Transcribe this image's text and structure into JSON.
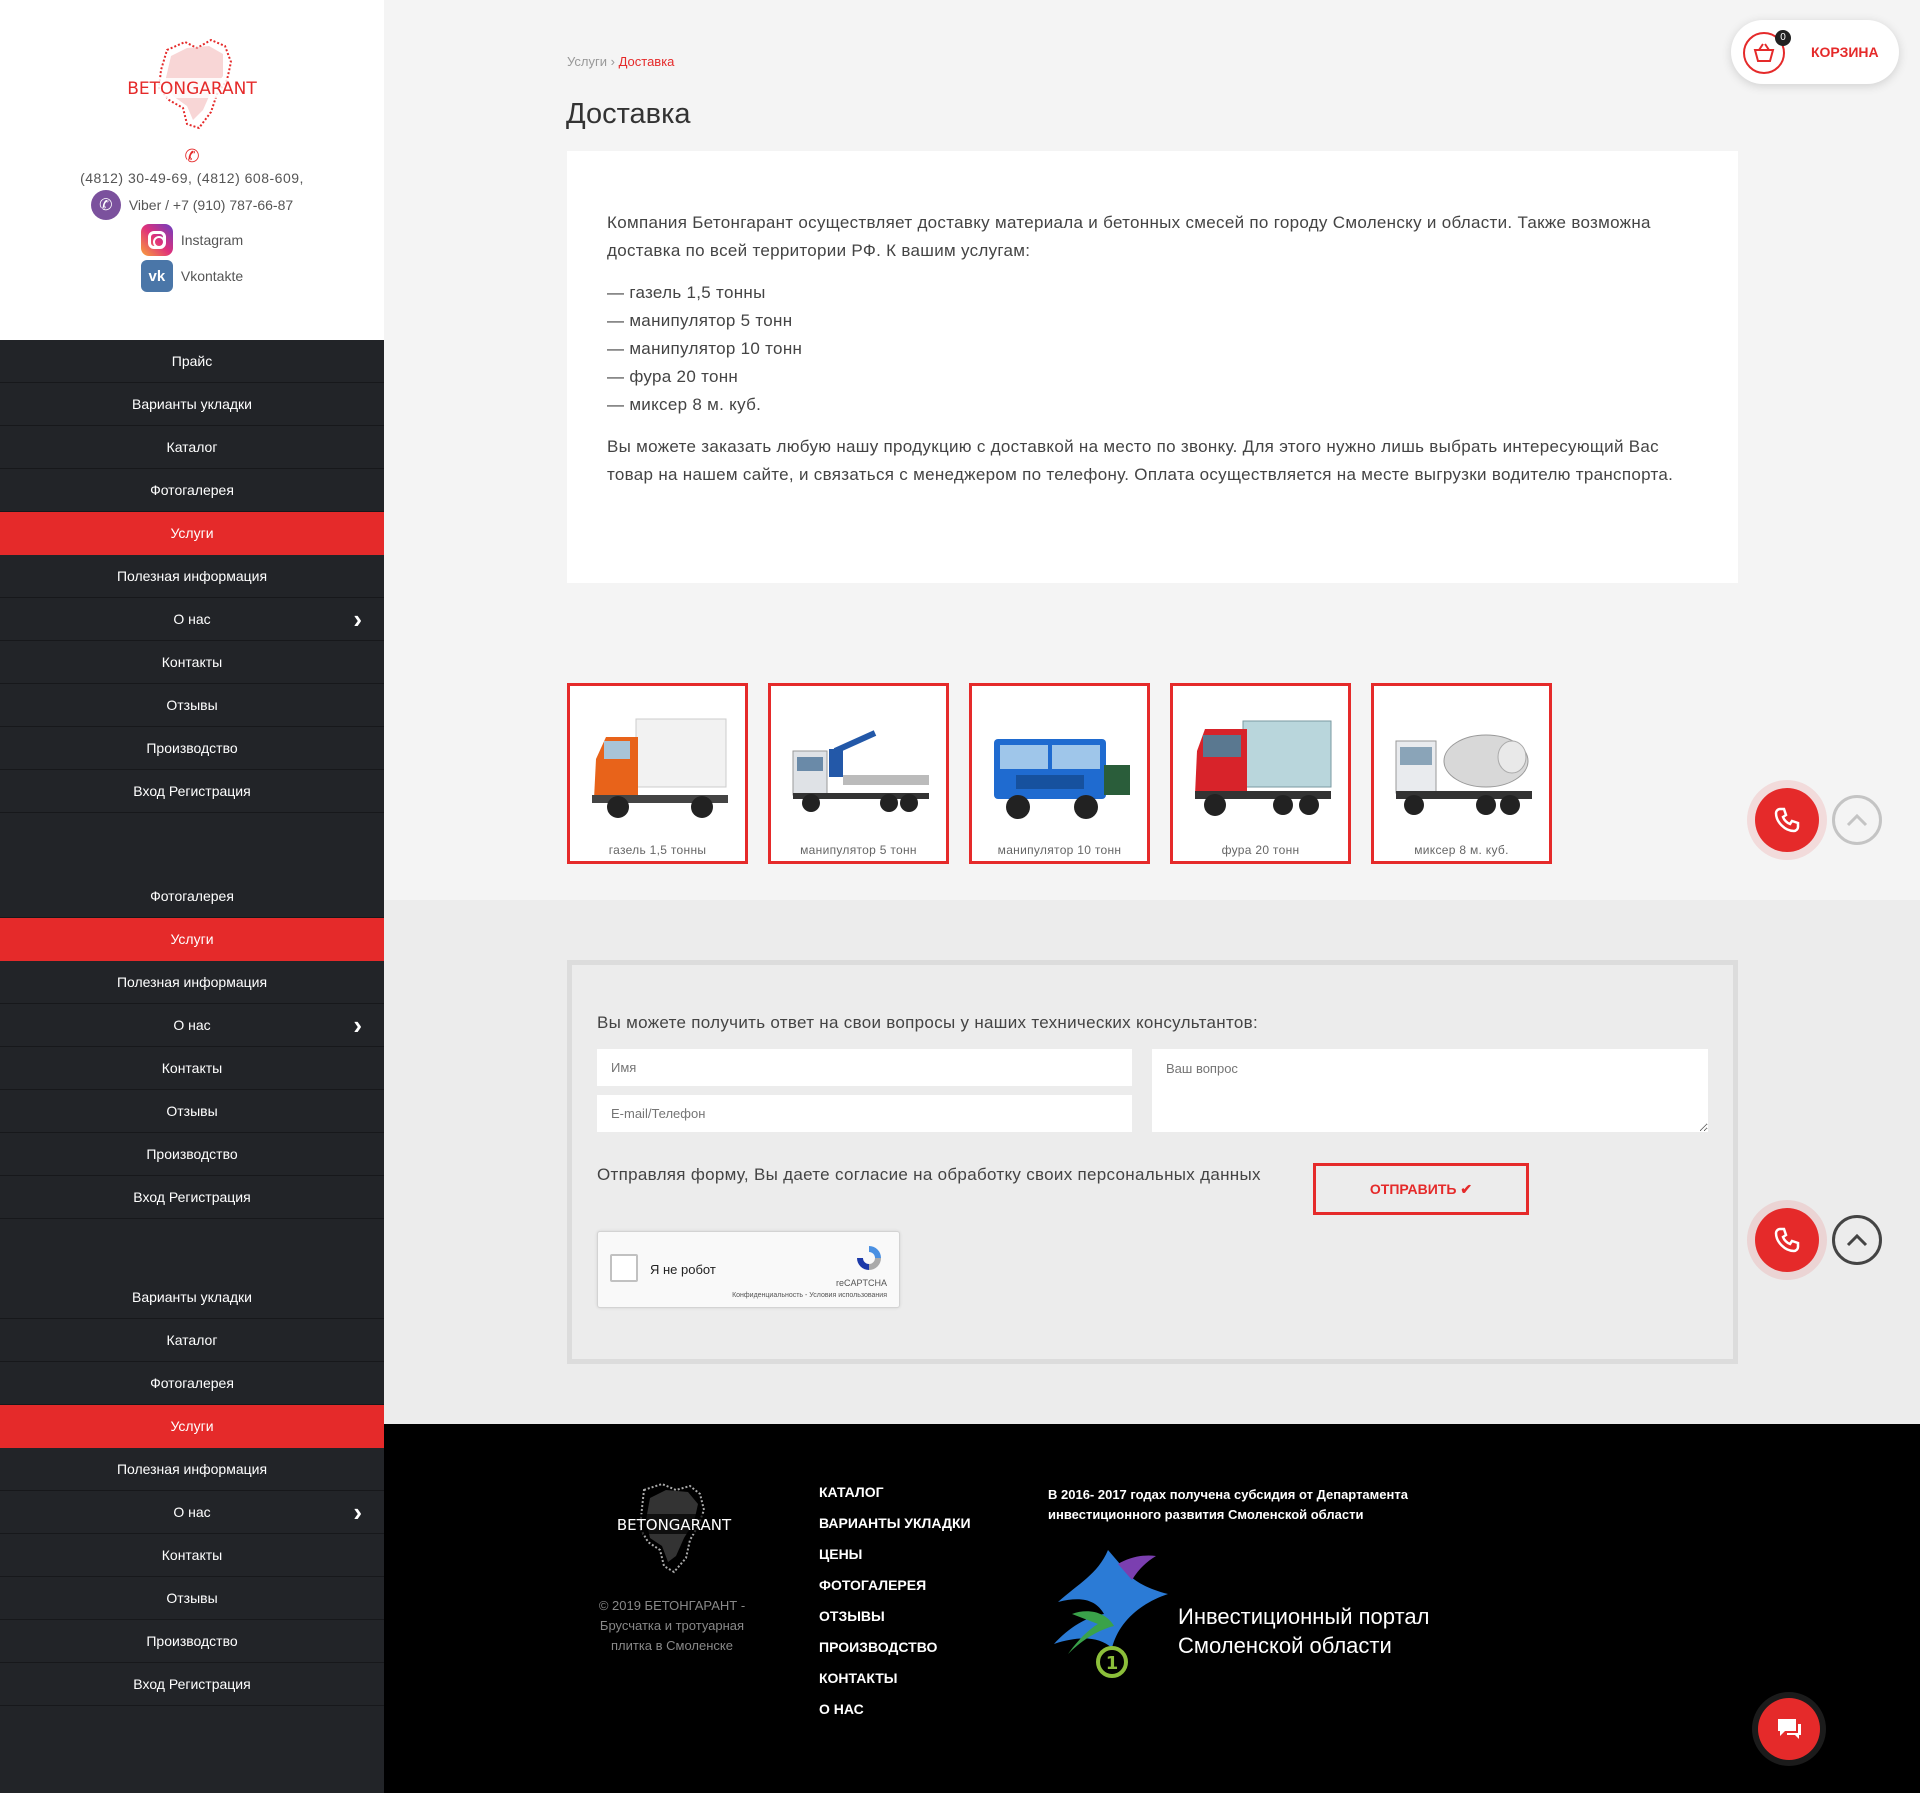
{
  "brand": {
    "logo_text": "BETONGARANT",
    "accent": "#e52a2a"
  },
  "contacts": {
    "phones": "(4812) 30-49-69, (4812) 608-609,",
    "viber": "Viber / +7 (910) 787-66-87",
    "instagram": "Instagram",
    "vkontakte": "Vkontakte"
  },
  "nav_block_1": [
    {
      "label": "Прайс"
    },
    {
      "label": "Варианты укладки"
    },
    {
      "label": "Каталог"
    },
    {
      "label": "Фотогалерея"
    },
    {
      "label": "Услуги"
    },
    {
      "label": "Полезная информация"
    },
    {
      "label": "О нас"
    },
    {
      "label": "Контакты"
    },
    {
      "label": "Отзывы"
    },
    {
      "label": "Производство"
    },
    {
      "label": "Вход Регистрация"
    }
  ],
  "nav_block_2": [
    {
      "label": "Фотогалерея"
    },
    {
      "label": "Услуги"
    },
    {
      "label": "Полезная информация"
    },
    {
      "label": "О нас"
    },
    {
      "label": "Контакты"
    },
    {
      "label": "Отзывы"
    },
    {
      "label": "Производство"
    },
    {
      "label": "Вход Регистрация"
    }
  ],
  "nav_block_3": [
    {
      "label": "Варианты укладки"
    },
    {
      "label": "Каталог"
    },
    {
      "label": "Фотогалерея"
    },
    {
      "label": "Услуги"
    },
    {
      "label": "Полезная информация"
    },
    {
      "label": "О нас"
    },
    {
      "label": "Контакты"
    },
    {
      "label": "Отзывы"
    },
    {
      "label": "Производство"
    },
    {
      "label": "Вход Регистрация"
    }
  ],
  "breadcrumb": {
    "parent": "Услуги",
    "separator": "›",
    "current": "Доставка"
  },
  "page_title": "Доставка",
  "content": {
    "intro": "Компания Бетонгарант осуществляет доставку материала и бетонных смесей по городу Смоленску и области. Также возможна доставка по всей территории РФ. К вашим услугам:",
    "services": [
      "— газель 1,5 тонны",
      "— манипулятор 5 тонн",
      "— манипулятор 10 тонн",
      "— фура 20 тонн",
      "— миксер 8 м. куб."
    ],
    "outro": "Вы можете заказать любую нашу продукцию с доставкой на место по звонку. Для этого нужно лишь выбрать интересующий Вас товар на нашем сайте, и связаться с менеджером по телефону. Оплата осуществляется на месте выгрузки водителю транспорта."
  },
  "trucks": [
    {
      "caption": "газель 1,5 тонны",
      "color": "#e8631a"
    },
    {
      "caption": "манипулятор 5 тонн",
      "color": "#dfe2e6"
    },
    {
      "caption": "манипулятор 10 тонн",
      "color": "#1f6bd0"
    },
    {
      "caption": "фура 20 тонн",
      "color": "#d8232a"
    },
    {
      "caption": "миксер 8 м. куб.",
      "color": "#e9ebee"
    }
  ],
  "form": {
    "title": "Вы можете получить ответ на свои вопросы у наших технических консультантов:",
    "name_placeholder": "Имя",
    "contact_placeholder": "E-mail/Телефон",
    "question_placeholder": "Ваш вопрос",
    "consent": "Отправляя форму, Вы даете согласие на обработку своих персональных данных",
    "submit_label": "ОТПРАВИТЬ",
    "captcha_label": "Я не робот",
    "captcha_brand": "reCAPTCHA",
    "captcha_terms": "Конфиденциальность - Условия использования"
  },
  "cart": {
    "label": "КОРЗИНА",
    "count": "0"
  },
  "footer": {
    "copyright": "© 2019 БЕТОНГАРАНТ - Брусчатка и тротуарная плитка в Смоленске",
    "nav": [
      "КАТАЛОГ",
      "ВАРИАНТЫ УКЛАДКИ",
      "ЦЕНЫ",
      "ФОТОГАЛЕРЕЯ",
      "ОТЗЫВЫ",
      "ПРОИЗВОДСТВО",
      "КОНТАКТЫ",
      "О НАС"
    ],
    "subsidy_note": "В 2016- 2017 годах получена субсидия от Департамента инвестиционного развития Смоленской области",
    "portal_line_1": "Инвестиционный портал",
    "portal_line_2": "Смоленской области"
  }
}
